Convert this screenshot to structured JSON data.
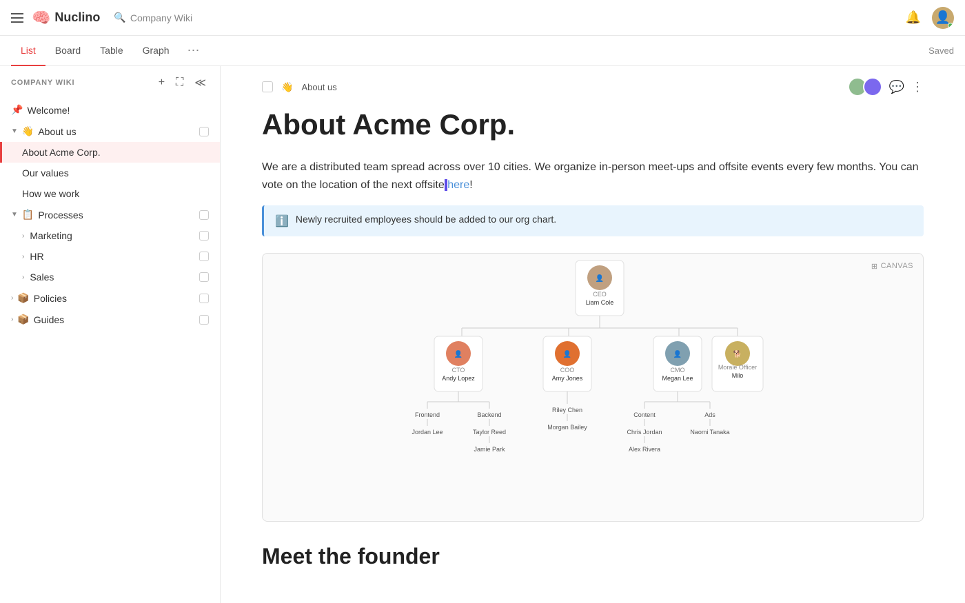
{
  "topbar": {
    "logo": "Nuclino",
    "search_placeholder": "Company Wiki",
    "saved_label": "Saved"
  },
  "tabs": [
    {
      "label": "List",
      "active": true
    },
    {
      "label": "Board",
      "active": false
    },
    {
      "label": "Table",
      "active": false
    },
    {
      "label": "Graph",
      "active": false
    }
  ],
  "sidebar": {
    "title": "COMPANY WIKI",
    "items": [
      {
        "id": "welcome",
        "label": "Welcome!",
        "icon": "📌",
        "indent": 0,
        "pin": true
      },
      {
        "id": "about-us",
        "label": "About us",
        "icon": "👋",
        "indent": 0,
        "expanded": true,
        "group": true
      },
      {
        "id": "about-acme",
        "label": "About Acme Corp.",
        "indent": 1,
        "active": true
      },
      {
        "id": "our-values",
        "label": "Our values",
        "indent": 1
      },
      {
        "id": "how-we-work",
        "label": "How we work",
        "indent": 1
      },
      {
        "id": "processes",
        "label": "Processes",
        "icon": "📋",
        "indent": 0,
        "group": true,
        "expanded": true
      },
      {
        "id": "marketing",
        "label": "Marketing",
        "indent": 1,
        "hasChildren": true
      },
      {
        "id": "hr",
        "label": "HR",
        "indent": 1,
        "hasChildren": true
      },
      {
        "id": "sales",
        "label": "Sales",
        "indent": 1,
        "hasChildren": true
      },
      {
        "id": "policies",
        "label": "Policies",
        "icon": "📦",
        "indent": 0,
        "group": true
      },
      {
        "id": "guides",
        "label": "Guides",
        "icon": "📦",
        "indent": 0,
        "group": true
      }
    ]
  },
  "content": {
    "breadcrumb_emoji": "👋",
    "breadcrumb_text": "About us",
    "page_title": "About Acme Corp.",
    "body_paragraph": "We are a distributed team spread across over 10 cities. We organize in-person meet-ups and offsite events every few months. You can vote on the location of the next offsite",
    "link_text": "here",
    "info_text": "Newly recruited employees should be added to our org chart.",
    "canvas_label": "CANVAS",
    "org_ceo": {
      "role": "CEO",
      "name": "Liam Cole"
    },
    "org_cto": {
      "role": "CTO",
      "name": "Andy Lopez"
    },
    "org_coo": {
      "role": "COO",
      "name": "Amy Jones"
    },
    "org_cmo": {
      "role": "CMO",
      "name": "Megan Lee"
    },
    "org_morale": {
      "role": "Morale Officer",
      "name": "Milo"
    },
    "org_leaves": [
      {
        "label": "Frontend",
        "child": "Jordan Lee"
      },
      {
        "label": "Backend",
        "child": "Taylor Reed",
        "grandchild": "Jamie Park"
      },
      {
        "label": "Riley Chen",
        "child": "Morgan Bailey"
      },
      {
        "label": "Content",
        "child": "Chris Jordan",
        "grandchild": "Alex Rivera"
      },
      {
        "label": "Ads",
        "child": "Naomi Tanaka"
      }
    ],
    "section_heading": "Meet the founder"
  }
}
